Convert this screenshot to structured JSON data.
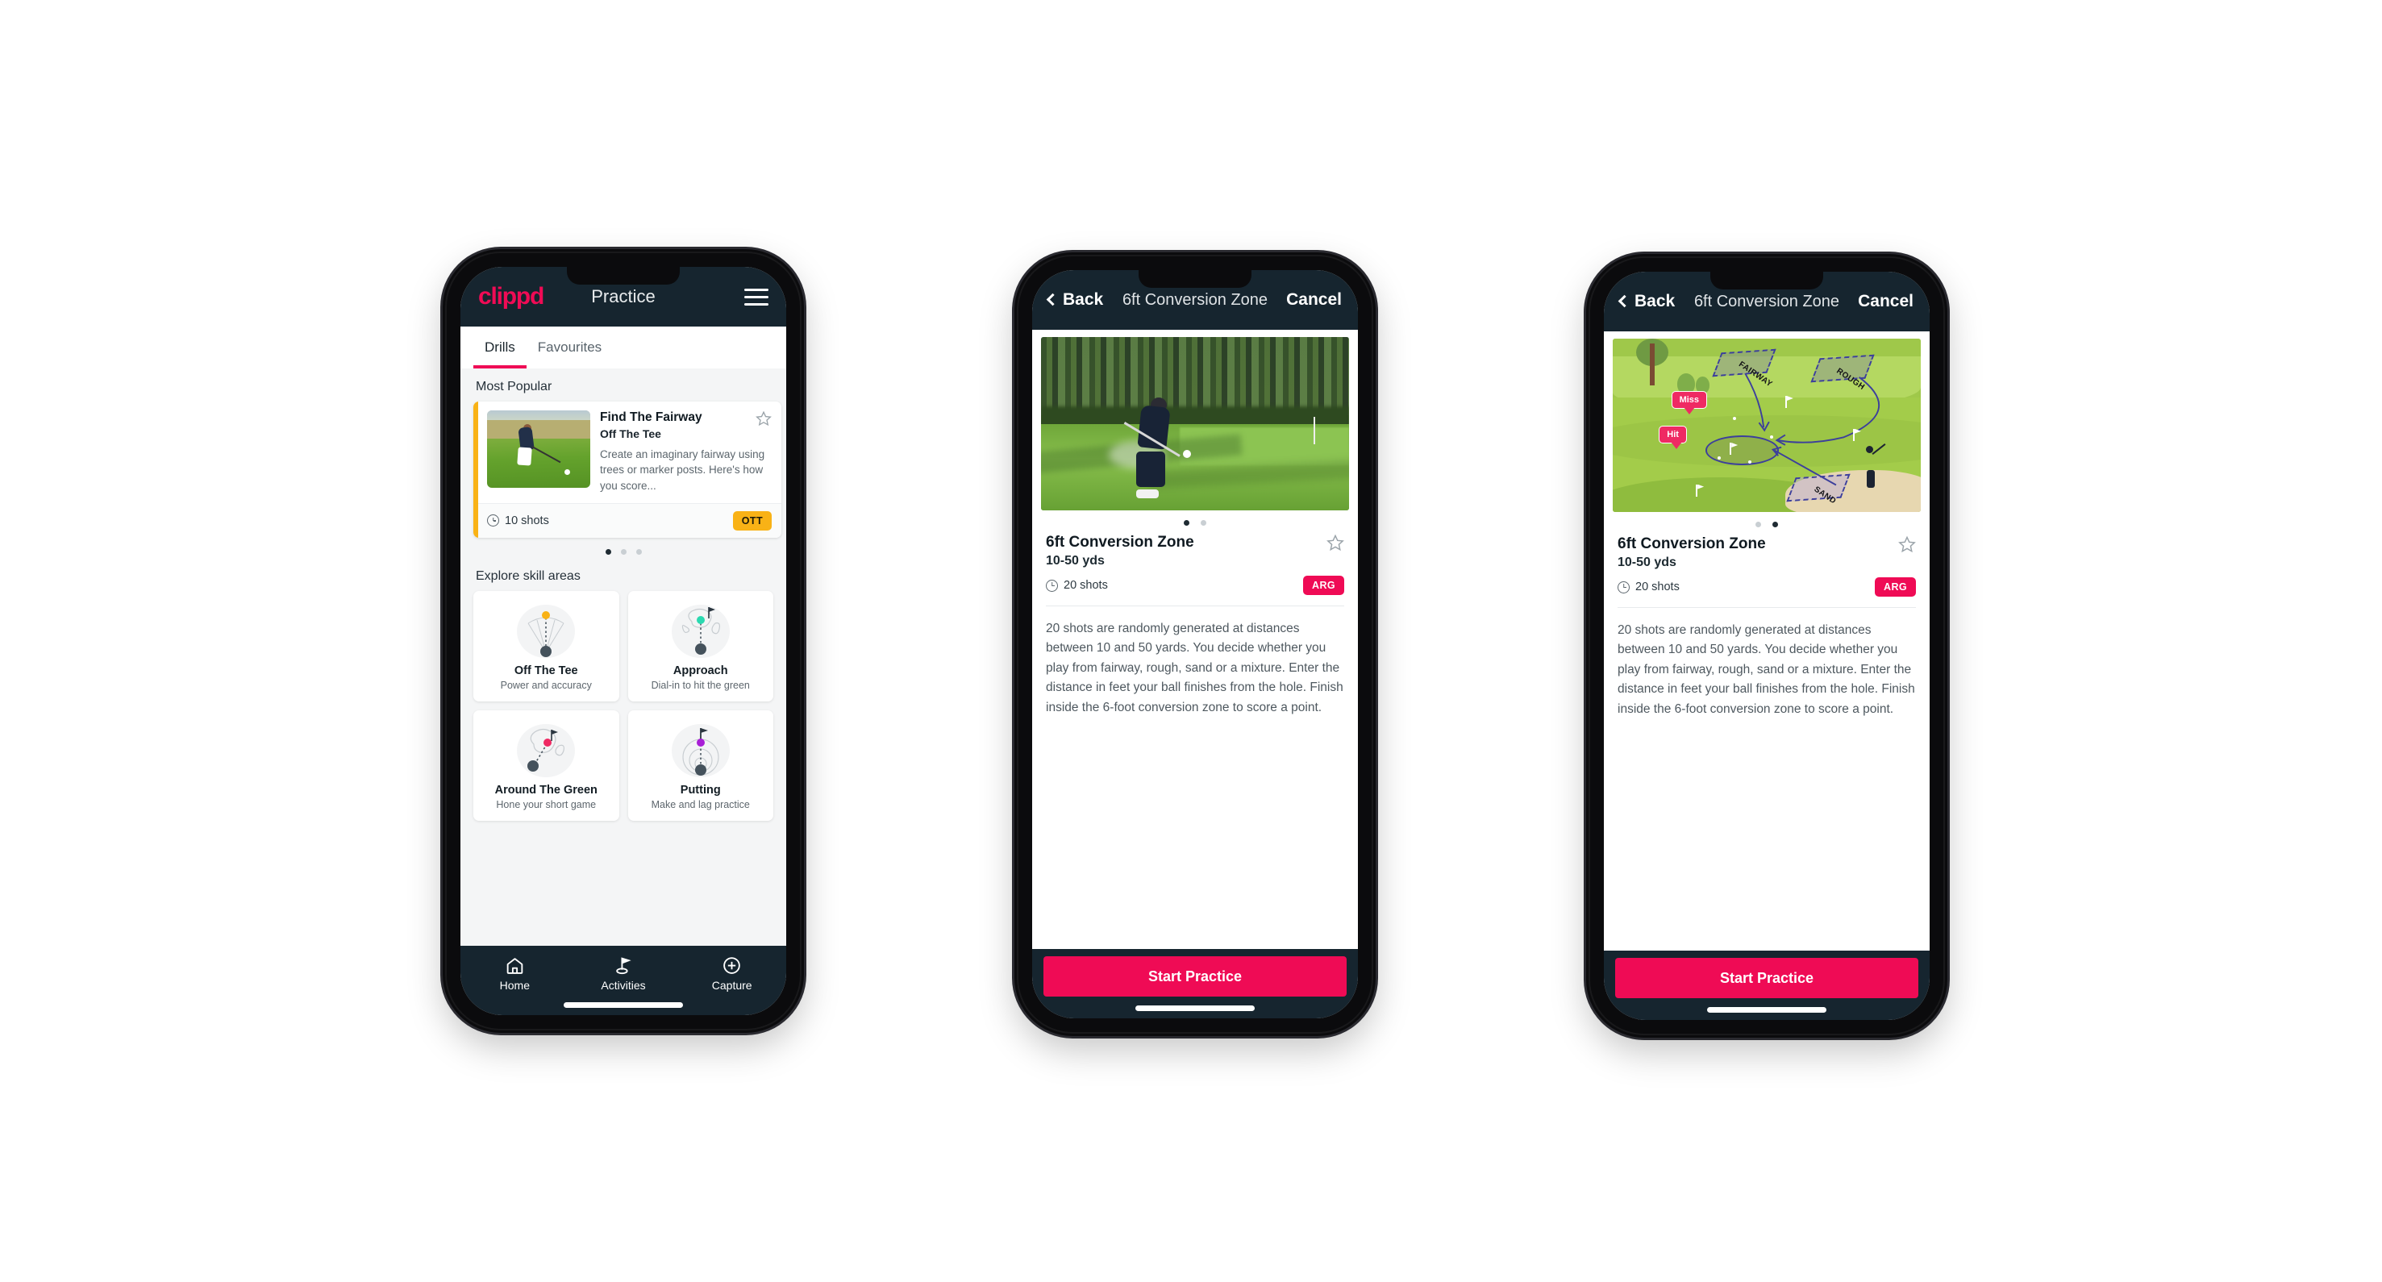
{
  "brand": {
    "logo_text": "clippd",
    "accent_pink": "#ef0b55",
    "dark_navy": "#16252f",
    "badge_yellow": "#f9b216"
  },
  "phone1": {
    "header": {
      "title": "Practice",
      "menu_icon": "hamburger-menu-icon"
    },
    "tabs": [
      {
        "label": "Drills",
        "active": true
      },
      {
        "label": "Favourites",
        "active": false
      }
    ],
    "most_popular": {
      "section_title": "Most Popular",
      "card": {
        "title": "Find The Fairway",
        "subtitle": "Off The Tee",
        "description": "Create an imaginary fairway using trees or marker posts. Here's how you score...",
        "shots": "10 shots",
        "badge": "OTT",
        "accent_color": "#f9b216",
        "favourite_icon": "star-outline-icon"
      },
      "carousel_dots": 3,
      "carousel_active_index": 0
    },
    "explore": {
      "section_title": "Explore skill areas",
      "cards": [
        {
          "name": "Off The Tee",
          "desc": "Power and accuracy",
          "icon": "tee-fan-icon",
          "dot_color": "#f9b216"
        },
        {
          "name": "Approach",
          "desc": "Dial-in to hit the green",
          "icon": "approach-green-icon",
          "dot_color": "#2ad9b0"
        },
        {
          "name": "Around The Green",
          "desc": "Hone your short game",
          "icon": "around-green-icon",
          "dot_color": "#ef2a63"
        },
        {
          "name": "Putting",
          "desc": "Make and lag practice",
          "icon": "putting-rings-icon",
          "dot_color": "#a81fd6"
        }
      ]
    },
    "bottom_nav": [
      {
        "label": "Home",
        "icon": "home-icon",
        "active": false
      },
      {
        "label": "Activities",
        "icon": "golf-flag-icon",
        "active": true
      },
      {
        "label": "Capture",
        "icon": "plus-circle-icon",
        "active": false
      }
    ]
  },
  "phone2": {
    "nav": {
      "back_label": "Back",
      "title": "6ft Conversion Zone",
      "cancel_label": "Cancel",
      "back_icon": "chevron-left-icon"
    },
    "hero": {
      "type": "photo",
      "alt": "golfer chipping onto green"
    },
    "carousel_dots": 2,
    "carousel_active_index": 0,
    "detail": {
      "title": "6ft Conversion Zone",
      "yardage": "10-50 yds",
      "shots": "20 shots",
      "badge": "ARG",
      "badge_color": "#ef0b55",
      "favourite_icon": "star-outline-icon",
      "description": "20 shots are randomly generated at distances between 10 and 50 yards. You decide whether you play from fairway, rough, sand or a mixture. Enter the distance in feet your ball finishes from the hole. Finish inside the 6-foot conversion zone to score a point."
    },
    "cta_label": "Start Practice"
  },
  "phone3": {
    "nav": {
      "back_label": "Back",
      "title": "6ft Conversion Zone",
      "cancel_label": "Cancel",
      "back_icon": "chevron-left-icon"
    },
    "hero": {
      "type": "illustration",
      "zone_labels": [
        "FAIRWAY",
        "ROUGH",
        "SAND"
      ],
      "tags": [
        "Miss",
        "Hit"
      ]
    },
    "carousel_dots": 2,
    "carousel_active_index": 1,
    "detail": {
      "title": "6ft Conversion Zone",
      "yardage": "10-50 yds",
      "shots": "20 shots",
      "badge": "ARG",
      "badge_color": "#ef0b55",
      "favourite_icon": "star-outline-icon",
      "description": "20 shots are randomly generated at distances between 10 and 50 yards. You decide whether you play from fairway, rough, sand or a mixture. Enter the distance in feet your ball finishes from the hole. Finish inside the 6-foot conversion zone to score a point."
    },
    "cta_label": "Start Practice"
  }
}
